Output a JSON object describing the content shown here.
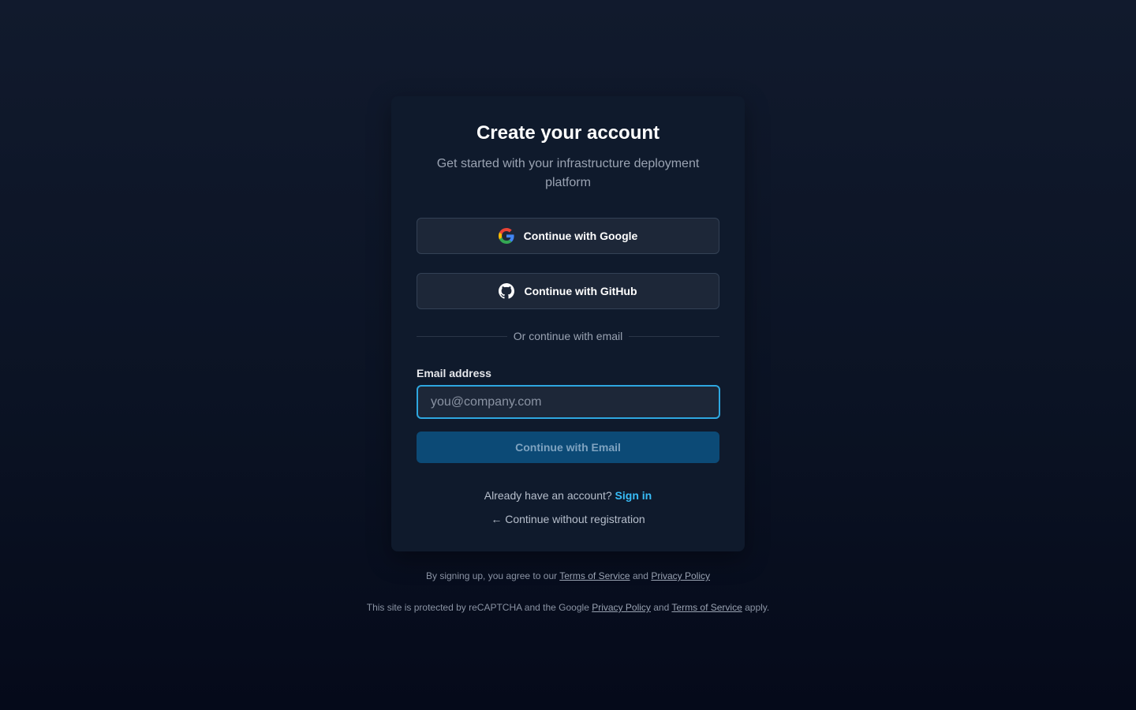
{
  "card": {
    "title": "Create your account",
    "subtitle": "Get started with your infrastructure deployment platform"
  },
  "oauth": {
    "google_label": "Continue with Google",
    "github_label": "Continue with GitHub"
  },
  "divider": {
    "text": "Or continue with email"
  },
  "email": {
    "label": "Email address",
    "placeholder": "you@company.com",
    "value": "",
    "submit_label": "Continue with Email"
  },
  "signin": {
    "prompt": "Already have an account?",
    "link": "Sign in"
  },
  "skip": {
    "arrow": "←",
    "label": "Continue without registration"
  },
  "legal": {
    "line1_prefix": "By signing up, you agree to our",
    "terms": "Terms of Service",
    "and": "and",
    "privacy": "Privacy Policy",
    "line2_prefix": "This site is protected by reCAPTCHA and the Google",
    "line2_suffix": "apply."
  },
  "colors": {
    "accent": "#38bdf8",
    "focus_border": "#2ea7e0",
    "primary_button": "#0c4a76",
    "card_bg": "#0f1a2c"
  },
  "icons": {
    "google": "google-icon",
    "github": "github-icon",
    "back": "arrow-left-icon"
  }
}
